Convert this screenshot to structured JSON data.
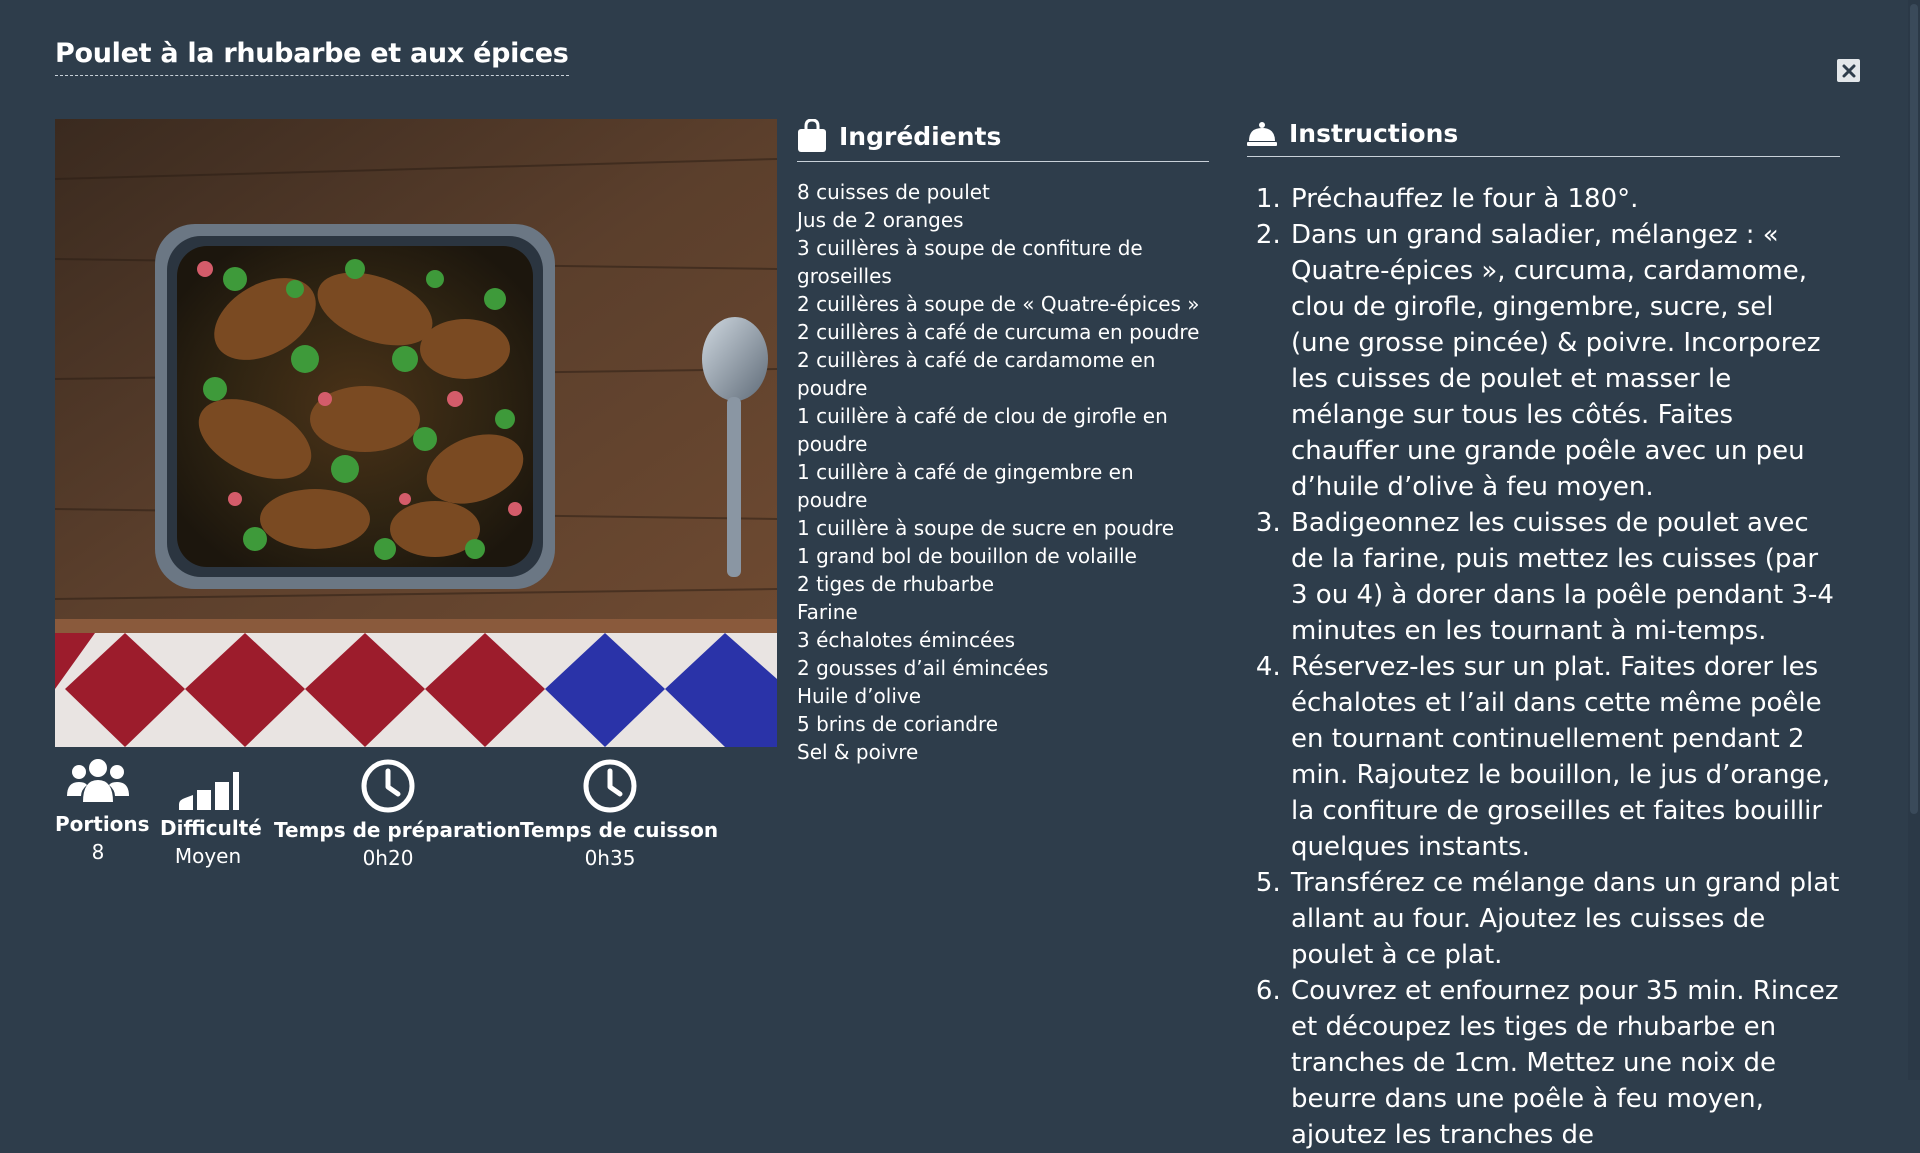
{
  "recipe": {
    "title": "Poulet à la rhubarbe et aux épices"
  },
  "stats": [
    {
      "label": "Portions",
      "value": "8",
      "icon": "users-icon"
    },
    {
      "label": "Difficulté",
      "value": "Moyen",
      "icon": "signal-bars-icon"
    },
    {
      "label": "Temps de préparation",
      "value": "0h20",
      "icon": "clock-icon"
    },
    {
      "label": "Temps de cuisson",
      "value": "0h35",
      "icon": "clock-icon"
    }
  ],
  "ingredients": {
    "heading": "Ingrédients",
    "icon": "shopping-bag-icon",
    "items": [
      "8 cuisses de poulet",
      "Jus de 2 oranges",
      "3 cuillères à soupe de confiture de groseilles",
      "2 cuillères à soupe de « Quatre-épices »",
      "2 cuillères à café de curcuma en poudre",
      "2 cuillères à café de cardamome en poudre",
      "1 cuillère à café de clou de girofle en poudre",
      "1 cuillère à café de gingembre en poudre",
      "1 cuillère à soupe de sucre en poudre",
      "1 grand bol de bouillon de volaille",
      "2 tiges de rhubarbe",
      "Farine",
      "3 échalotes émincées",
      "2 gousses d’ail émincées",
      "Huile d’olive",
      "5 brins de coriandre",
      "Sel & poivre"
    ]
  },
  "instructions": {
    "heading": "Instructions",
    "icon": "cloche-icon",
    "steps": [
      "Préchauffez le four à 180°.",
      "Dans un grand saladier, mélangez : « Quatre-épices », curcuma, cardamome, clou de girofle, gingembre, sucre, sel (une grosse pincée) & poivre. Incorporez les cuisses de poulet et masser le mélange sur tous les côtés. Faites chauffer une grande poêle avec un peu d’huile d’olive à feu moyen.",
      "Badigeonnez les cuisses de poulet avec de la farine, puis mettez les cuisses (par 3 ou 4) à dorer dans la poêle pendant 3-4 minutes en les tournant à mi-temps.",
      "Réservez-les sur un plat. Faites dorer les échalotes et l’ail dans cette même poêle en tournant continuellement pendant 2 min. Rajoutez le bouillon, le jus d’orange, la confiture de groseilles et faites bouillir quelques instants.",
      "Transférez ce mélange dans un grand plat allant au four. Ajoutez les cuisses de poulet à ce plat.",
      "Couvrez et enfournez pour 35 min. Rincez et découpez les tiges de rhubarbe en tranches de 1cm. Mettez une noix de beurre dans une poêle à feu moyen, ajoutez les tranches de"
    ]
  },
  "colors": {
    "background": "#2e3d4b",
    "text": "#ffffff"
  }
}
